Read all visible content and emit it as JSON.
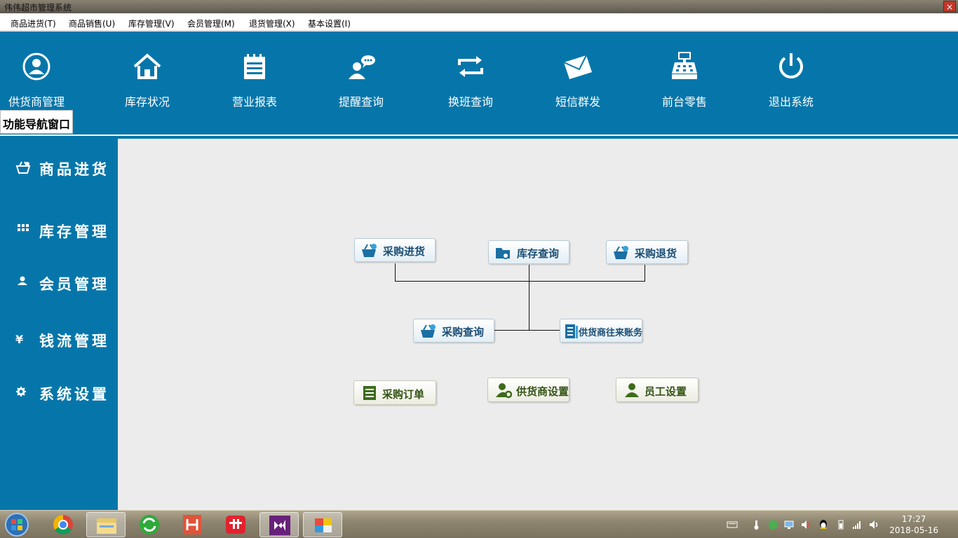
{
  "window": {
    "title": "伟伟超市管理系统",
    "close_label": "×"
  },
  "menu": [
    {
      "label": "商品进货(T)"
    },
    {
      "label": "商品销售(U)"
    },
    {
      "label": "库存管理(V)"
    },
    {
      "label": "会员管理(M)"
    },
    {
      "label": "退货管理(X)"
    },
    {
      "label": "基本设置(I)"
    }
  ],
  "toolbar": [
    {
      "label": "供货商管理",
      "icon": "user-circle-icon"
    },
    {
      "label": "库存状况",
      "icon": "home-icon"
    },
    {
      "label": "营业报表",
      "icon": "notepad-icon"
    },
    {
      "label": "提醒查询",
      "icon": "chat-user-icon"
    },
    {
      "label": "换班查询",
      "icon": "swap-arrows-icon"
    },
    {
      "label": "短信群发",
      "icon": "envelope-icon"
    },
    {
      "label": "前台零售",
      "icon": "cash-register-icon"
    },
    {
      "label": "退出系统",
      "icon": "power-icon"
    }
  ],
  "nav_tab": "功能导航窗口",
  "sidebar": [
    {
      "label": "商品进货",
      "icon": "basket-icon"
    },
    {
      "label": "库存管理",
      "icon": "grid-icon"
    },
    {
      "label": "会员管理",
      "icon": "person-icon"
    },
    {
      "label": "钱流管理",
      "icon": "yen-icon"
    },
    {
      "label": "系统设置",
      "icon": "gear-icon"
    }
  ],
  "flow": {
    "purchase_in": "采购进货",
    "stock_query": "库存查询",
    "purchase_return": "采购退货",
    "purchase_query": "采购查询",
    "supplier_accounts": "供货商往来账务",
    "purchase_order": "采购订单",
    "supplier_settings": "供货商设置",
    "staff_settings": "员工设置"
  },
  "taskbar": {
    "time": "17:27",
    "date": "2018-05-16",
    "apps": [
      "start-orb-icon",
      "chrome-icon",
      "file-explorer-icon",
      "refresh-app-icon",
      "hbuilder-icon",
      "youdao-icon",
      "visual-studio-icon",
      "app-window-icon"
    ]
  },
  "colors": {
    "accent": "#0676aa",
    "flow_text": "#1b4e75",
    "green_text": "#335314"
  }
}
